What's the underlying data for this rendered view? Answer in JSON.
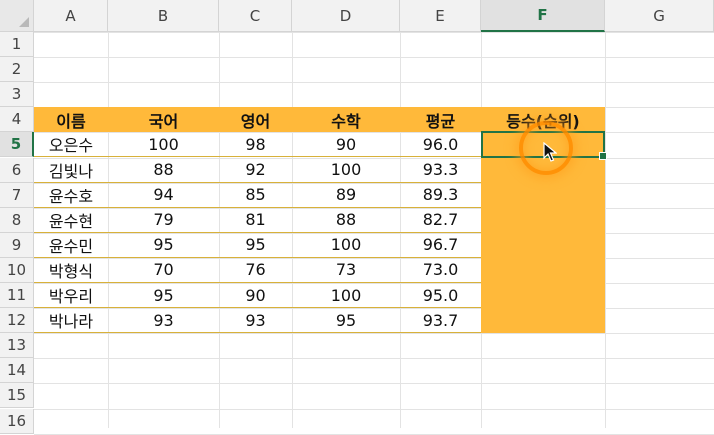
{
  "columns": [
    "A",
    "B",
    "C",
    "D",
    "E",
    "F",
    "G"
  ],
  "active_column": "F",
  "rows": [
    "1",
    "2",
    "3",
    "4",
    "5",
    "6",
    "7",
    "8",
    "9",
    "10",
    "11",
    "12",
    "13",
    "14",
    "15",
    "16"
  ],
  "active_row": "5",
  "table": {
    "headers": [
      "이름",
      "국어",
      "영어",
      "수학",
      "평균",
      "등수(순위)"
    ],
    "records": [
      {
        "name": "오은수",
        "kor": "100",
        "eng": "98",
        "math": "90",
        "avg": "96.0"
      },
      {
        "name": "김빛나",
        "kor": "88",
        "eng": "92",
        "math": "100",
        "avg": "93.3"
      },
      {
        "name": "윤수호",
        "kor": "94",
        "eng": "85",
        "math": "89",
        "avg": "89.3"
      },
      {
        "name": "윤수현",
        "kor": "79",
        "eng": "81",
        "math": "88",
        "avg": "82.7"
      },
      {
        "name": "윤수민",
        "kor": "95",
        "eng": "95",
        "math": "100",
        "avg": "96.7"
      },
      {
        "name": "박형식",
        "kor": "70",
        "eng": "76",
        "math": "73",
        "avg": "73.0"
      },
      {
        "name": "박우리",
        "kor": "95",
        "eng": "90",
        "math": "100",
        "avg": "95.0"
      },
      {
        "name": "박나라",
        "kor": "93",
        "eng": "93",
        "math": "95",
        "avg": "93.7"
      }
    ]
  },
  "colors": {
    "table_fill": "#ffb93a",
    "selection": "#217346",
    "click_highlight": "#ff8c00"
  },
  "icons": {
    "cursor": "mouse-pointer-icon",
    "click": "click-indicator-icon"
  }
}
